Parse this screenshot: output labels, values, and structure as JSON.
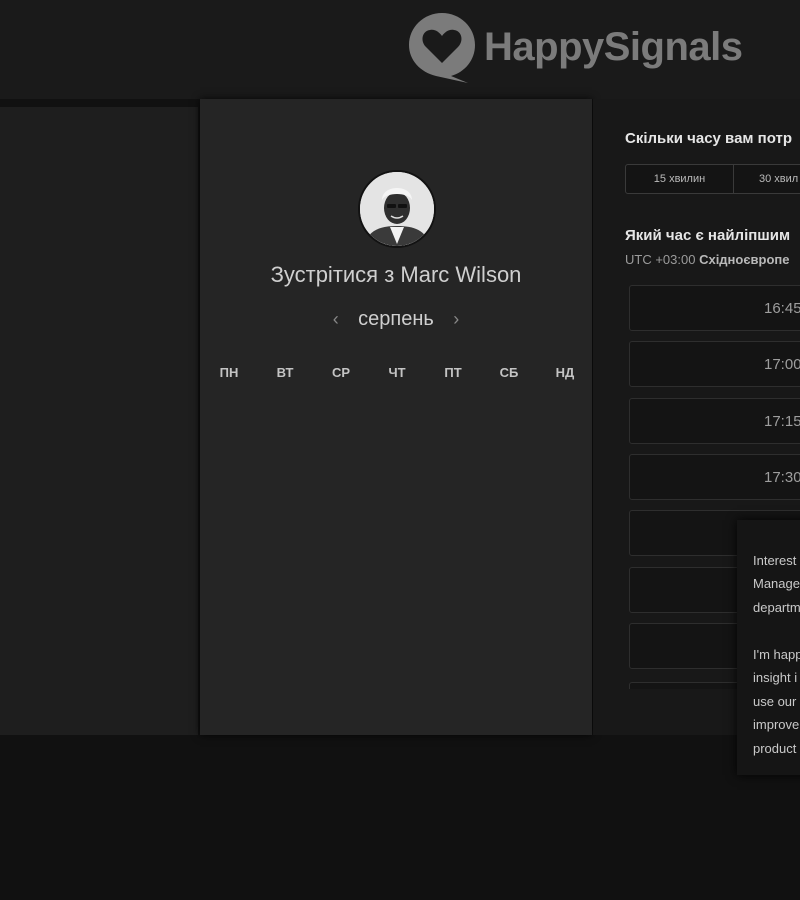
{
  "brand": {
    "name": "HappySignals",
    "color": "#7b7b7b"
  },
  "calendar": {
    "title": "Зустрітися з Marc Wilson",
    "month": "серпень",
    "prev_icon": "‹",
    "next_icon": "›",
    "weekdays": [
      "ПН",
      "ВТ",
      "СР",
      "ЧТ",
      "ПТ",
      "СБ",
      "НД"
    ]
  },
  "scheduler": {
    "duration_question": "Скільки часу вам потр",
    "durations": [
      "15 хвилин",
      "30 хвил"
    ],
    "time_question": "Який час є найліпшим",
    "timezone_offset": "UTC +03:00",
    "timezone_name": "Східноєвропе",
    "slots": [
      "16:45",
      "17:00",
      "17:15",
      "17:30",
      "",
      "",
      ""
    ]
  },
  "popup": {
    "lines": [
      "Interest",
      "Manage",
      "departm",
      "",
      "I'm happ",
      "insight i",
      "use our",
      "improve",
      "product"
    ]
  }
}
